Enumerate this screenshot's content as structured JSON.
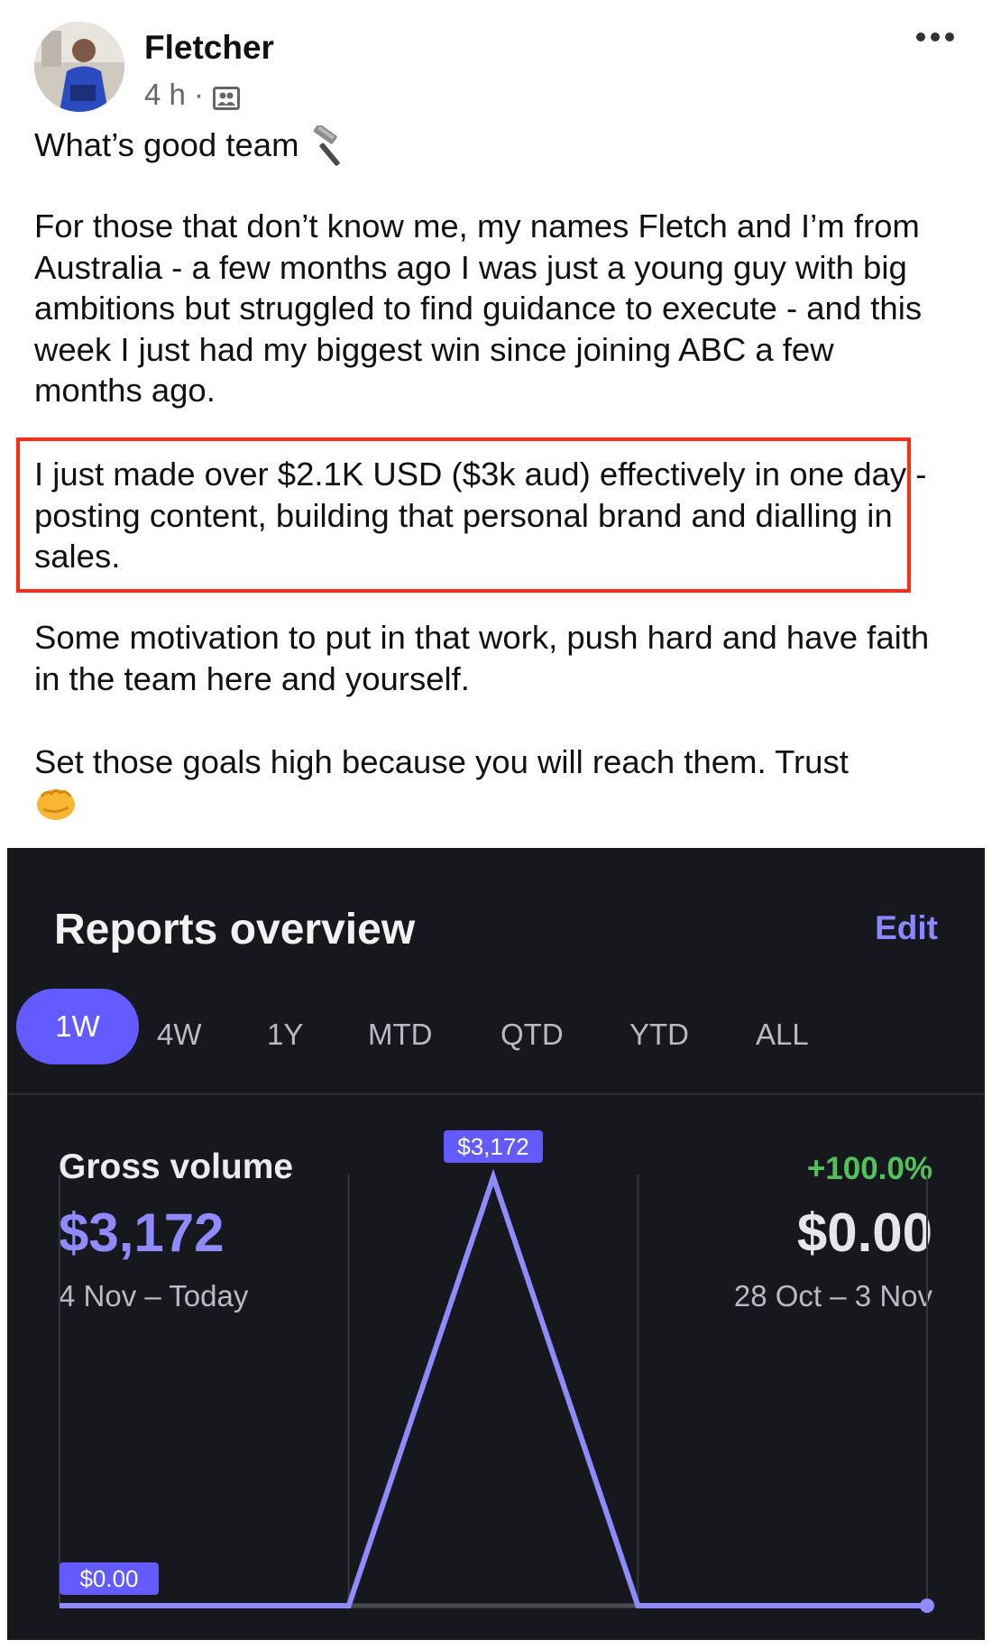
{
  "post": {
    "author": "Fletcher",
    "time": "4 h ·",
    "paragraphs": {
      "greeting": "What’s good team",
      "intro": "For those that don’t know me, my names Fletch and I’m from Australia - a few months ago I was just a young guy with big ambitions but struggled to find guidance to execute - and this week I just had my biggest win since joining ABC a few months ago.",
      "highlight": "I just made over $2.1K USD ($3k aud) effectively in one day - posting content, building that personal brand and dialling in sales.",
      "motivation": "Some motivation to put in that work, push hard and have faith in the team here and yourself.",
      "closing": "Set those goals high because you will reach them. Trust"
    },
    "icons": {
      "menu": "more-horizontal-icon",
      "audience": "group-audience-icon",
      "greeting_emoji": "hammer-emoji",
      "closing_emoji": "oncoming-fist-emoji"
    },
    "highlight_color": "#ff2b14"
  },
  "reports": {
    "title": "Reports overview",
    "edit_label": "Edit",
    "tabs": [
      {
        "label": "1W",
        "active": true
      },
      {
        "label": "4W",
        "active": false
      },
      {
        "label": "1Y",
        "active": false
      },
      {
        "label": "MTD",
        "active": false
      },
      {
        "label": "QTD",
        "active": false
      },
      {
        "label": "YTD",
        "active": false
      },
      {
        "label": "ALL",
        "active": false
      }
    ],
    "gross_volume": {
      "label": "Gross volume",
      "change": "+100.0%",
      "current_value": "$3,172",
      "current_range": "4 Nov – Today",
      "previous_value": "$0.00",
      "previous_range": "28 Oct – 3 Nov"
    },
    "colors": {
      "background": "#17181d",
      "accent": "#635bff",
      "line": "#8f8bff",
      "positive": "#50c25a",
      "comparison_line": "#4a4b52"
    }
  },
  "chart_data": {
    "type": "line",
    "x": [
      0,
      1,
      2,
      3,
      4,
      5,
      6
    ],
    "series": [
      {
        "values": [
          0,
          0,
          0,
          3172,
          0,
          0,
          0
        ]
      },
      {
        "values": [
          0,
          0,
          0,
          0,
          0,
          0,
          0
        ]
      }
    ],
    "annotations": [
      {
        "label": "$3,172",
        "x": 3,
        "y": 3172
      },
      {
        "label": "$0.00",
        "x": 0,
        "y": 0
      }
    ],
    "ylim": [
      0,
      3172
    ],
    "grid": "vertical"
  }
}
